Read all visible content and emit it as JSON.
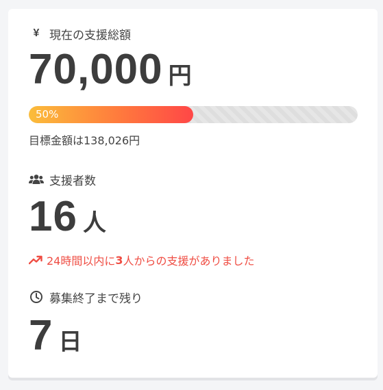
{
  "funding": {
    "currency_icon": "yen-icon",
    "label": "現在の支援総額",
    "amount": "70,000",
    "unit": "円",
    "progress_percent": 50,
    "progress_label": "50%",
    "goal_text": "目標金額は138,026円"
  },
  "supporters": {
    "icon": "users-icon",
    "label": "支援者数",
    "count": "16",
    "unit": "人",
    "trend_icon": "trending-up-icon",
    "trend_prefix": "24時間以内に",
    "trend_count": "3",
    "trend_suffix": "人からの支援がありました"
  },
  "deadline": {
    "icon": "clock-icon",
    "label": "募集終了まで残り",
    "days": "7",
    "unit": "日"
  },
  "colors": {
    "accent_red": "#ef4d43",
    "progress_start": "#fbbd3b",
    "progress_end": "#ff4747"
  }
}
